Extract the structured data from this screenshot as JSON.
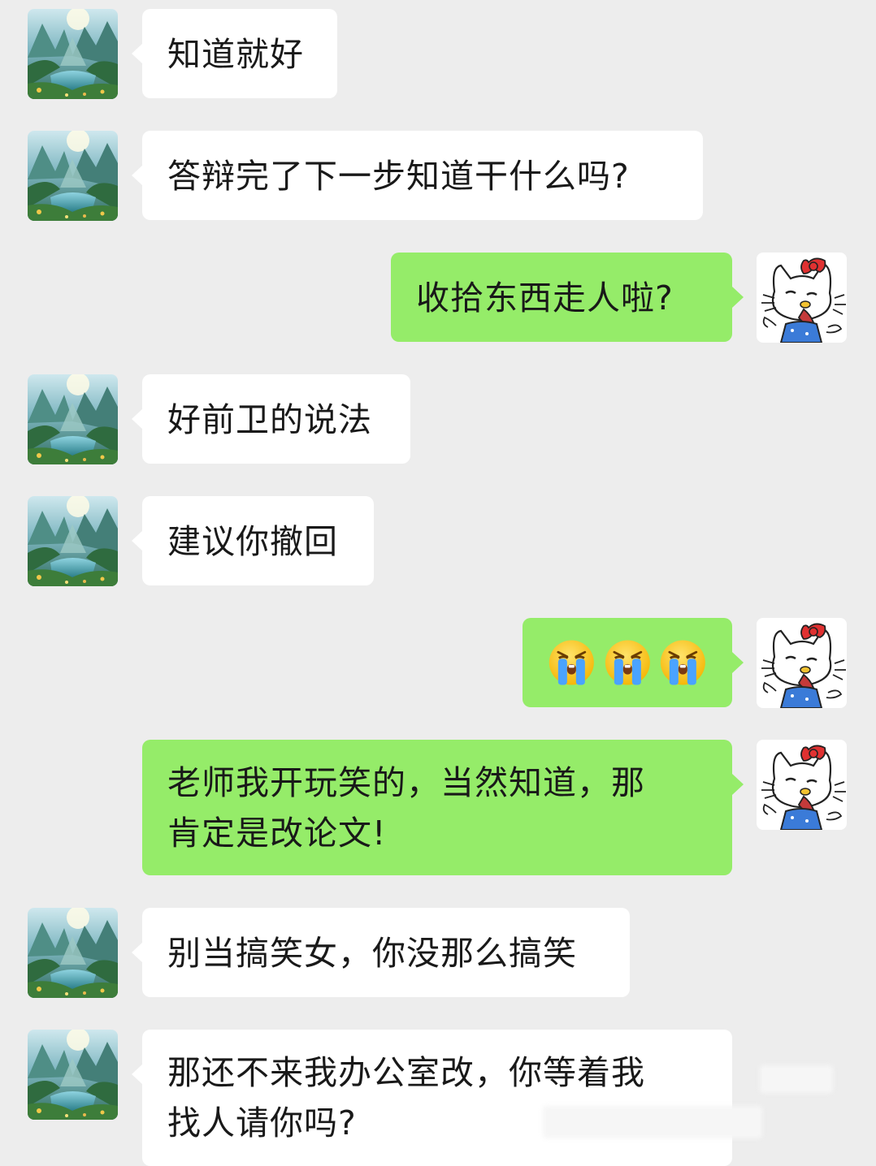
{
  "messages": [
    {
      "side": "in",
      "text": "知道就好"
    },
    {
      "side": "in",
      "text": "答辩完了下一步知道干什么吗?"
    },
    {
      "side": "out",
      "text": "收拾东西走人啦?"
    },
    {
      "side": "in",
      "text": "好前卫的说法"
    },
    {
      "side": "in",
      "text": "建议你撤回"
    },
    {
      "side": "out",
      "emoji": [
        "loudly-crying-face",
        "loudly-crying-face",
        "loudly-crying-face"
      ]
    },
    {
      "side": "out",
      "lines": [
        "老师我开玩笑的，当然知道，那",
        "肯定是改论文!"
      ]
    },
    {
      "side": "in",
      "text": "别当搞笑女，你没那么搞笑"
    },
    {
      "side": "in",
      "lines": [
        "那还不来我办公室改，你等着我",
        "找人请你吗?"
      ]
    }
  ],
  "colors": {
    "background": "#ededed",
    "incoming_bubble": "#ffffff",
    "outgoing_bubble": "#95ec69",
    "text": "#191919"
  },
  "avatars": {
    "contact": "mountain-lake-landscape-avatar",
    "self": "hello-kitty-crying-avatar"
  }
}
